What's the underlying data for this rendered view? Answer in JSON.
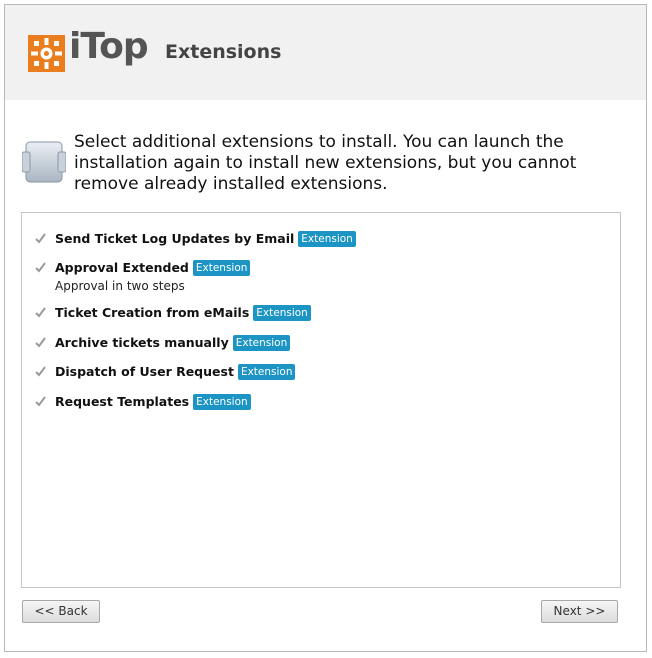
{
  "header": {
    "logo_text": "iTop",
    "title": "Extensions"
  },
  "intro": {
    "icon": "refresh-icon",
    "text": "Select additional extensions to install. You can launch the installation again to install new extensions, but you cannot remove already installed extensions."
  },
  "extensions": [
    {
      "label": "Send Ticket Log Updates by Email",
      "badge": "Extension",
      "description": "",
      "checked": true
    },
    {
      "label": "Approval Extended",
      "badge": "Extension",
      "description": "Approval in two steps",
      "checked": true
    },
    {
      "label": "Ticket Creation from eMails",
      "badge": "Extension",
      "description": "",
      "checked": true
    },
    {
      "label": "Archive tickets manually",
      "badge": "Extension",
      "description": "",
      "checked": true
    },
    {
      "label": "Dispatch of User Request",
      "badge": "Extension",
      "description": "",
      "checked": true
    },
    {
      "label": "Request Templates",
      "badge": "Extension",
      "description": "",
      "checked": true
    }
  ],
  "buttons": {
    "back": "<< Back",
    "next": "Next >>"
  },
  "colors": {
    "brand_orange": "#ea7d1e",
    "badge_blue": "#1c94c4",
    "header_bg": "#f1f1f1"
  }
}
